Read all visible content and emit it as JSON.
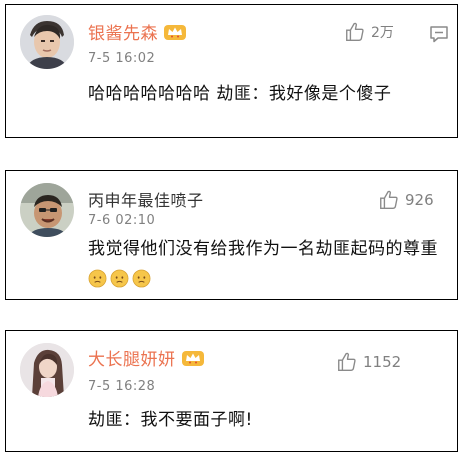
{
  "comments": [
    {
      "username": "银酱先森",
      "time": "7-5 16:02",
      "text": "哈哈哈哈哈哈哈 劫匪：我好像是个傻子",
      "likes": "2万",
      "verified_badge": true,
      "name_color": "#eb7350"
    },
    {
      "username": "丙申年最佳喷子",
      "time": "7-6 02:10",
      "text": "我觉得他们没有给我作为一名劫匪起码的尊重",
      "emoji_count": 3,
      "likes": "926",
      "verified_badge": false,
      "name_color": "#333333"
    },
    {
      "username": "大长腿妍妍",
      "time": "7-5 16:28",
      "text": "劫匪：我不要面子啊!",
      "likes": "1152",
      "verified_badge": true,
      "name_color": "#eb7350"
    }
  ],
  "icons": {
    "like": "thumbs-up-icon",
    "reply": "comment-bubble-icon",
    "badge": "crown-vip-icon",
    "emoji": "sad-face-emoji"
  },
  "colors": {
    "accent_name": "#eb7350",
    "meta_gray": "#808080",
    "emoji_yellow": "#f6c64a"
  }
}
